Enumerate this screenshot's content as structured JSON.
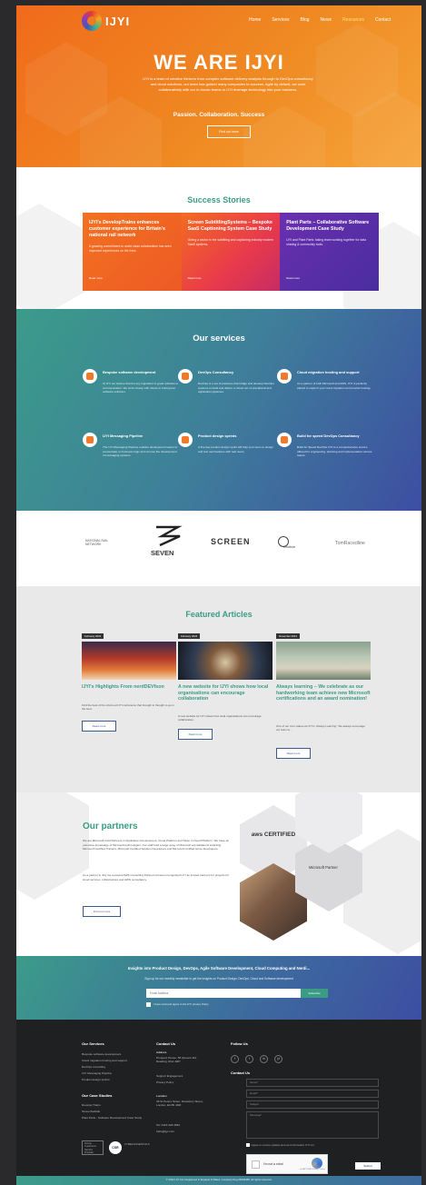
{
  "nav": {
    "logo_text": "IJYI",
    "links": [
      "Home",
      "Services",
      "Blog",
      "News",
      "Resources",
      "Contact"
    ]
  },
  "hero": {
    "title": "WE ARE IJYI",
    "text": "IJYI is a team of creative thinkers from complex software delivery analysis through to DevOps consultancy and cloud solutions, our team has guided many companies to success. Agile by default, we work collaboratively with our in-house teams to IJYI leverage technology into your business.",
    "tagline": "Passion. Collaboration. Success",
    "button": "Find out more"
  },
  "success": {
    "title": "Success Stories",
    "cards": [
      {
        "title": "IJYI's DevelopTrains enhances customer experience for Britain's national rail network",
        "text": "A growing commitment to world class collaboration has seen improved experiences on the lines.",
        "more": "Read more"
      },
      {
        "title": "Screen SubtitlingSystems – Bespoke SaaS Captioning System Case Study",
        "text": "Giving a sector in the subtitling and captioning industry modern SaaS systems.",
        "more": "Read more"
      },
      {
        "title": "Plant Parts – Collaborative Software Development Case Study",
        "text": "IJYI and Plant Parts: taking team working together for data sharing & community tools.",
        "more": "Read more"
      }
    ]
  },
  "services": {
    "title": "Our services",
    "items": [
      {
        "title": "Bespoke software development",
        "text": "At IJYI we believe that the key ingredient to great software is communication. We work closely with clients to build great software solutions."
      },
      {
        "title": "DevOps Consultancy",
        "text": "DevOps is a set of practices that bridge and develop DevOps systems to build and deliver a robust set of operational and application pipelines."
      },
      {
        "title": "Cloud migration hosting and support",
        "text": "As a partner of both Microsoft and AWS, IJYI is perfectly placed to support your cloud migration and provide hosting."
      },
      {
        "title": "IJYI Messaging Pipeline",
        "text": "The IJYI Messaging Pipeline enables development teams to concentrate on business logic and remove the development of messaging systems."
      },
      {
        "title": "Product design sprints",
        "text": "A five day product design sprint will help your team to design and test new features with real users."
      },
      {
        "title": "Build for speed DevOps Consultancy",
        "text": "Build for Speed DevOps IJYI is a comprehensive service offered for engineering, planning and implementation across teams."
      }
    ]
  },
  "clients": [
    "NATIONAL RAIL NETWORK",
    "SEVEN",
    "SCREEN",
    "Innotron",
    "TomRacedline"
  ],
  "featured": {
    "title": "Featured Articles",
    "articles": [
      {
        "date": "February 2022",
        "title": "IJYI's Highlights From nerdDEVfson",
        "text": "Find the best of the reformed IJYI conference that brought in thought to go in the best.",
        "button": "Read more"
      },
      {
        "date": "February 2022",
        "title": "A new website for IJYI shows how local organisations can encourage collaboration",
        "text": "A new website for IJYI shows how local organisations can encourage collaboration.",
        "button": "Read more"
      },
      {
        "date": "November 2021",
        "title": "Always learning – We celebrate as our hardworking team achieve new Microsoft certifications and an award nomination!",
        "text": "One of our core values at IJYI is 'Always Learning'. We always encourage our team to...",
        "button": "Read more"
      }
    ]
  },
  "partners": {
    "title": "Our partners",
    "text1": "We are Microsoft Gold Partners in Application Development, Cloud Platform and Silver in Cloud Platform. We have an extensive knowledge of Microsoft technologies. Our staff hold a large array of Microsoft accreditations including Microsoft Certified Trainers, Microsoft Certified Solution Developers and Microsoft certified Azure Developers.",
    "text2": "As a partner in July we received AWS Consulting Partners Amazon recognised IJYI as trusted partners for projects for cloud services, infrastructure and AWS consultancy.",
    "button": "Find out more",
    "aws": "aws CERTIFIED",
    "microsoft": "Microsoft Partner"
  },
  "newsletter": {
    "title": "Insights into Product Design, DevOps, Agile Software Development, Cloud Computing and Nerdi...",
    "subtitle": "Sign up for our monthly newsletter to get the insights on Product Design, DevOps, Cloud and Software development",
    "placeholder": "Email Address",
    "button": "Subscribe",
    "consent": "I have read and agree to the IJYI privacy Policy"
  },
  "footer": {
    "services_title": "Our Services",
    "services": [
      "Bespoke software development",
      "Cloud migration hosting and support",
      "DevOps consulting",
      "IJYI Messaging Pipeline",
      "Product design sprints"
    ],
    "case_title": "Our Case Studies",
    "cases": [
      "Develop Trains",
      "ScreenSubtitle",
      "Plant Parts - Software Development Case Study"
    ],
    "contact_title": "Contact Us",
    "address_label": "Address",
    "address": "Prospect House, 58 Queens Rd, Reading, RG1 4RP",
    "links": [
      "Support Engagement",
      "Privacy Policy"
    ],
    "second_label": "Location",
    "second_address": "36 St Peters Street, Dewsbury Street, London, EC3N 4DR",
    "phone": "Tel: 0118 328 2862",
    "email": "hello@ijyi.com",
    "follow_title": "Follow Us",
    "social": [
      "f",
      "t",
      "in",
      "yt"
    ],
    "contact_form_title": "Contact Us",
    "fields": [
      "Name*",
      "Email*",
      "Subject",
      "Message*"
    ],
    "consent": "I agree to receive updates and send information IJYI Ltd",
    "recaptcha_label": "I'm not a robot",
    "recaptcha_sub": "reCAPTCHA Privacy - Terms",
    "submit": "Submit",
    "badge1": "Ozone Customers Service Provider",
    "badge2": "CSR",
    "badge2_text": "CYBER ESSENTIALS",
    "bottom": "© 2022 IJYI Ltd. Registered in England & Wales. Company Reg 08449488. All rights reserved."
  }
}
